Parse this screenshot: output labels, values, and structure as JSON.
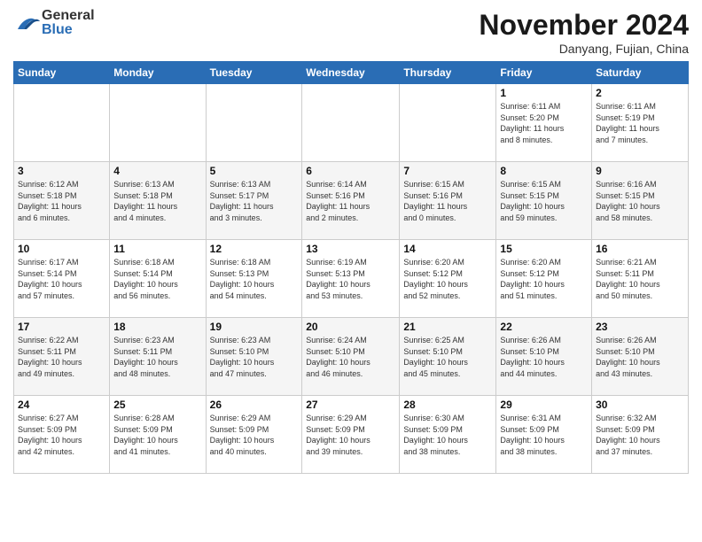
{
  "header": {
    "logo_general": "General",
    "logo_blue": "Blue",
    "month": "November 2024",
    "location": "Danyang, Fujian, China"
  },
  "weekdays": [
    "Sunday",
    "Monday",
    "Tuesday",
    "Wednesday",
    "Thursday",
    "Friday",
    "Saturday"
  ],
  "weeks": [
    [
      {
        "day": "",
        "info": ""
      },
      {
        "day": "",
        "info": ""
      },
      {
        "day": "",
        "info": ""
      },
      {
        "day": "",
        "info": ""
      },
      {
        "day": "",
        "info": ""
      },
      {
        "day": "1",
        "info": "Sunrise: 6:11 AM\nSunset: 5:20 PM\nDaylight: 11 hours\nand 8 minutes."
      },
      {
        "day": "2",
        "info": "Sunrise: 6:11 AM\nSunset: 5:19 PM\nDaylight: 11 hours\nand 7 minutes."
      }
    ],
    [
      {
        "day": "3",
        "info": "Sunrise: 6:12 AM\nSunset: 5:18 PM\nDaylight: 11 hours\nand 6 minutes."
      },
      {
        "day": "4",
        "info": "Sunrise: 6:13 AM\nSunset: 5:18 PM\nDaylight: 11 hours\nand 4 minutes."
      },
      {
        "day": "5",
        "info": "Sunrise: 6:13 AM\nSunset: 5:17 PM\nDaylight: 11 hours\nand 3 minutes."
      },
      {
        "day": "6",
        "info": "Sunrise: 6:14 AM\nSunset: 5:16 PM\nDaylight: 11 hours\nand 2 minutes."
      },
      {
        "day": "7",
        "info": "Sunrise: 6:15 AM\nSunset: 5:16 PM\nDaylight: 11 hours\nand 0 minutes."
      },
      {
        "day": "8",
        "info": "Sunrise: 6:15 AM\nSunset: 5:15 PM\nDaylight: 10 hours\nand 59 minutes."
      },
      {
        "day": "9",
        "info": "Sunrise: 6:16 AM\nSunset: 5:15 PM\nDaylight: 10 hours\nand 58 minutes."
      }
    ],
    [
      {
        "day": "10",
        "info": "Sunrise: 6:17 AM\nSunset: 5:14 PM\nDaylight: 10 hours\nand 57 minutes."
      },
      {
        "day": "11",
        "info": "Sunrise: 6:18 AM\nSunset: 5:14 PM\nDaylight: 10 hours\nand 56 minutes."
      },
      {
        "day": "12",
        "info": "Sunrise: 6:18 AM\nSunset: 5:13 PM\nDaylight: 10 hours\nand 54 minutes."
      },
      {
        "day": "13",
        "info": "Sunrise: 6:19 AM\nSunset: 5:13 PM\nDaylight: 10 hours\nand 53 minutes."
      },
      {
        "day": "14",
        "info": "Sunrise: 6:20 AM\nSunset: 5:12 PM\nDaylight: 10 hours\nand 52 minutes."
      },
      {
        "day": "15",
        "info": "Sunrise: 6:20 AM\nSunset: 5:12 PM\nDaylight: 10 hours\nand 51 minutes."
      },
      {
        "day": "16",
        "info": "Sunrise: 6:21 AM\nSunset: 5:11 PM\nDaylight: 10 hours\nand 50 minutes."
      }
    ],
    [
      {
        "day": "17",
        "info": "Sunrise: 6:22 AM\nSunset: 5:11 PM\nDaylight: 10 hours\nand 49 minutes."
      },
      {
        "day": "18",
        "info": "Sunrise: 6:23 AM\nSunset: 5:11 PM\nDaylight: 10 hours\nand 48 minutes."
      },
      {
        "day": "19",
        "info": "Sunrise: 6:23 AM\nSunset: 5:10 PM\nDaylight: 10 hours\nand 47 minutes."
      },
      {
        "day": "20",
        "info": "Sunrise: 6:24 AM\nSunset: 5:10 PM\nDaylight: 10 hours\nand 46 minutes."
      },
      {
        "day": "21",
        "info": "Sunrise: 6:25 AM\nSunset: 5:10 PM\nDaylight: 10 hours\nand 45 minutes."
      },
      {
        "day": "22",
        "info": "Sunrise: 6:26 AM\nSunset: 5:10 PM\nDaylight: 10 hours\nand 44 minutes."
      },
      {
        "day": "23",
        "info": "Sunrise: 6:26 AM\nSunset: 5:10 PM\nDaylight: 10 hours\nand 43 minutes."
      }
    ],
    [
      {
        "day": "24",
        "info": "Sunrise: 6:27 AM\nSunset: 5:09 PM\nDaylight: 10 hours\nand 42 minutes."
      },
      {
        "day": "25",
        "info": "Sunrise: 6:28 AM\nSunset: 5:09 PM\nDaylight: 10 hours\nand 41 minutes."
      },
      {
        "day": "26",
        "info": "Sunrise: 6:29 AM\nSunset: 5:09 PM\nDaylight: 10 hours\nand 40 minutes."
      },
      {
        "day": "27",
        "info": "Sunrise: 6:29 AM\nSunset: 5:09 PM\nDaylight: 10 hours\nand 39 minutes."
      },
      {
        "day": "28",
        "info": "Sunrise: 6:30 AM\nSunset: 5:09 PM\nDaylight: 10 hours\nand 38 minutes."
      },
      {
        "day": "29",
        "info": "Sunrise: 6:31 AM\nSunset: 5:09 PM\nDaylight: 10 hours\nand 38 minutes."
      },
      {
        "day": "30",
        "info": "Sunrise: 6:32 AM\nSunset: 5:09 PM\nDaylight: 10 hours\nand 37 minutes."
      }
    ]
  ]
}
